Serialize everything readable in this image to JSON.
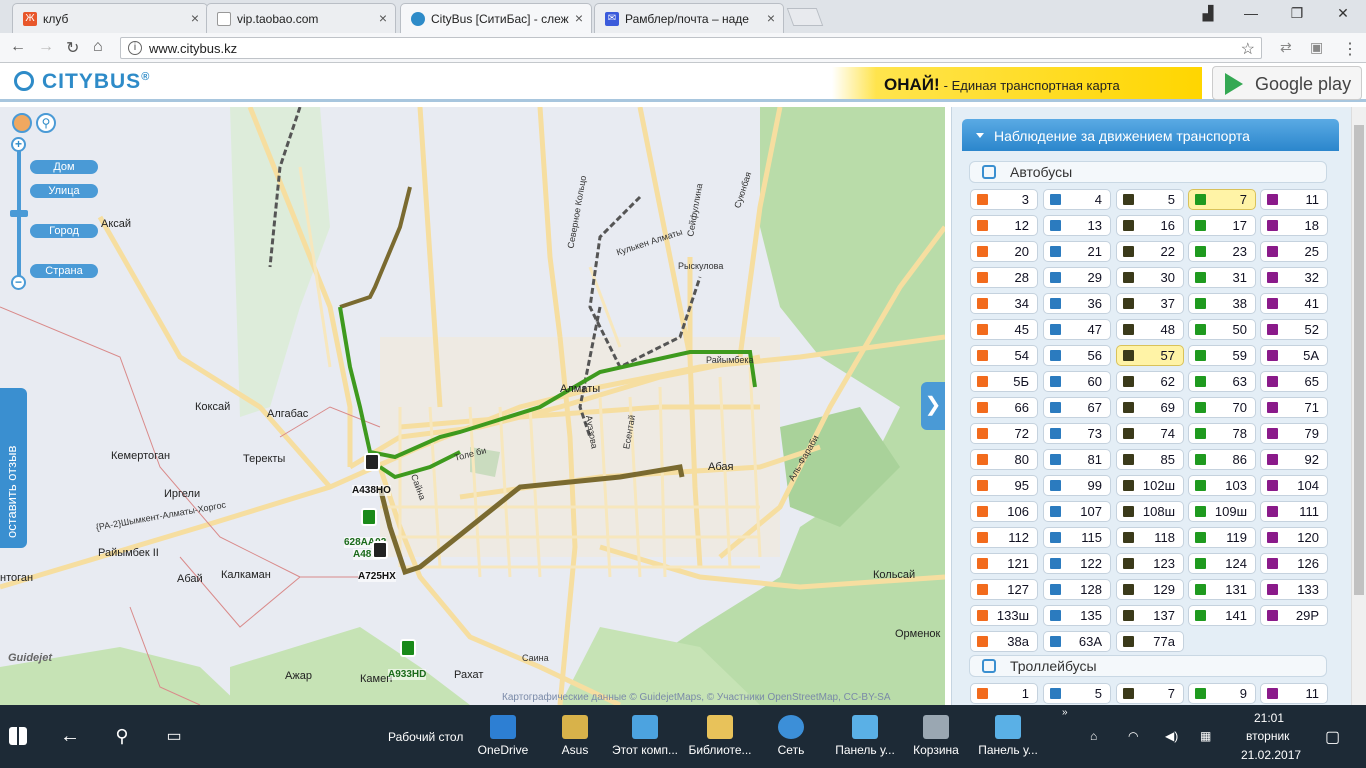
{
  "browser": {
    "tabs": [
      {
        "title": "клуб",
        "favicon_color": "#e8562a"
      },
      {
        "title": "vip.taobao.com",
        "favicon_color": "#ffffff"
      },
      {
        "title": "CityBus [СитиБас] - слеж",
        "favicon_color": "#2e8bc8"
      },
      {
        "title": "Рамблер/почта – наде",
        "favicon_color": "#3b5bdb"
      }
    ],
    "url": "www.citybus.kz"
  },
  "site": {
    "logo": "CITYBUS",
    "logo_mark": "®",
    "banner_brand": "ОНАЙ!",
    "banner_text": "- Единая транспортная карта",
    "gplay": "Google play"
  },
  "map": {
    "zoom_levels": [
      "Дом",
      "Улица",
      "Город",
      "Страна"
    ],
    "feedback": "оставить отзыв",
    "attribution": "Картографические данные © GuidejetMaps, © Участники OpenStreetMap, CC-BY-SA",
    "places": [
      {
        "name": "Аксай"
      },
      {
        "name": "Коксай"
      },
      {
        "name": "Алгабас"
      },
      {
        "name": "Кемертоган"
      },
      {
        "name": "Теректы"
      },
      {
        "name": "Иргели"
      },
      {
        "name": "Райымбек II"
      },
      {
        "name": "Абай"
      },
      {
        "name": "Калкаман"
      },
      {
        "name": "Алматы"
      },
      {
        "name": "Абая"
      },
      {
        "name": "Сайна"
      },
      {
        "name": "Кольсай"
      },
      {
        "name": "Орменок"
      },
      {
        "name": "Ажар"
      },
      {
        "name": "Рахат"
      },
      {
        "name": "Камен"
      },
      {
        "name": "Саина"
      },
      {
        "name": "Рыскулова"
      },
      {
        "name": "Райымбека"
      },
      {
        "name": "Толе би"
      },
      {
        "name": "Кулькен Алматы"
      },
      {
        "name": "Сейфуллина"
      },
      {
        "name": "Суюнбая"
      },
      {
        "name": "Северное Кольцо"
      },
      {
        "name": "{РА-2}Шымкент-Алматы-Хоргос"
      },
      {
        "name": "нтоган"
      },
      {
        "name": "Аль-Фараби"
      },
      {
        "name": "Ауэзова"
      },
      {
        "name": "Есентай"
      }
    ],
    "plates": [
      "А438НО",
      "628АА02",
      "А48...",
      "А725НХ",
      "А933НD"
    ],
    "logo": "Guidejet"
  },
  "panel": {
    "title": "Наблюдение за движением транспорта",
    "buses_label": "Автобусы",
    "trolley_label": "Троллейбусы",
    "bus_routes": [
      "3",
      "4",
      "5",
      "7",
      "11",
      "12",
      "13",
      "16",
      "17",
      "18",
      "20",
      "21",
      "22",
      "23",
      "25",
      "28",
      "29",
      "30",
      "31",
      "32",
      "34",
      "36",
      "37",
      "38",
      "41",
      "45",
      "47",
      "48",
      "50",
      "52",
      "54",
      "56",
      "57",
      "59",
      "5А",
      "5Б",
      "60",
      "62",
      "63",
      "65",
      "66",
      "67",
      "69",
      "70",
      "71",
      "72",
      "73",
      "74",
      "78",
      "79",
      "80",
      "81",
      "85",
      "86",
      "92",
      "95",
      "99",
      "102ш",
      "103",
      "104",
      "106",
      "107",
      "108ш",
      "109ш",
      "111",
      "112",
      "115",
      "118",
      "119",
      "120",
      "121",
      "122",
      "123",
      "124",
      "126",
      "127",
      "128",
      "129",
      "131",
      "133",
      "133ш",
      "135",
      "137",
      "141",
      "29Р",
      "38а",
      "63А",
      "77а"
    ],
    "selected_routes": [
      "7",
      "57"
    ],
    "trolley_routes": [
      "1",
      "5",
      "7",
      "9",
      "11"
    ],
    "swatch_colors": [
      "#f26b1d",
      "#2b7bbf",
      "#3b3a1a",
      "#1f9a1f",
      "#8a1a8a"
    ]
  },
  "taskbar": {
    "desktop_label": "Рабочий стол",
    "apps": [
      "OneDrive",
      "Asus",
      "Этот комп...",
      "Библиоте...",
      "Сеть",
      "Панель у...",
      "Корзина",
      "Панель у..."
    ],
    "time": "21:01",
    "day": "вторник",
    "date": "21.02.2017"
  }
}
